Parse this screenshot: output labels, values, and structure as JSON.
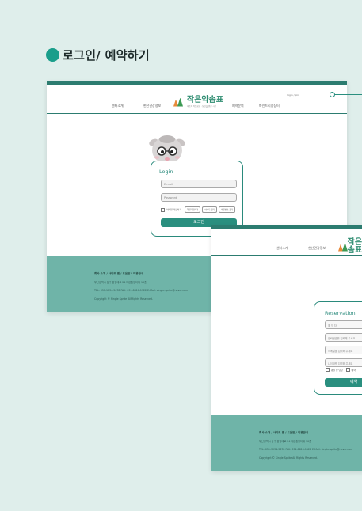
{
  "section": {
    "title": "로그인/ 예약하기"
  },
  "brand": {
    "name": "작은약솜표",
    "tagline": "마음속 작은쉼표 · 당신을 위한 시간",
    "accent": "#2a8f7f"
  },
  "header": {
    "util": "login / join",
    "nav_left": [
      "센터소개",
      "현산건강정보"
    ],
    "nav_right": [
      "예약문의",
      "마인드리상장터"
    ]
  },
  "login": {
    "title": "Login",
    "email_placeholder": "E-mail",
    "password_placeholder": "Password",
    "remember_label": "이메일 저장하기",
    "links": [
      "회원가입하기",
      "아이디 찾기",
      "비밀번호 찾기"
    ],
    "submit_label": "로그인"
  },
  "reservation": {
    "title": "Reservation",
    "fields": [
      "예 약 자",
      "연락번호를 입력해 주세요",
      "이메일을 입력해 주세요",
      "나이대를 입력해 주세요"
    ],
    "options": [
      "평일 상 담당",
      "예약"
    ],
    "submit_label": "예약"
  },
  "footer": {
    "links": "회사 소개 / 사이트 맵 / 도움말 / 이용안내",
    "address": "부산광역시 동구 중앙대로 24 다온중앙타워 16층",
    "contact": "TEL: 051-1234-5678  FAX: 051-8810-1122  E-Mail: single.sprite@naver.com",
    "copyright": "Copyright ©  Single Sprite All Rights Reserved."
  }
}
